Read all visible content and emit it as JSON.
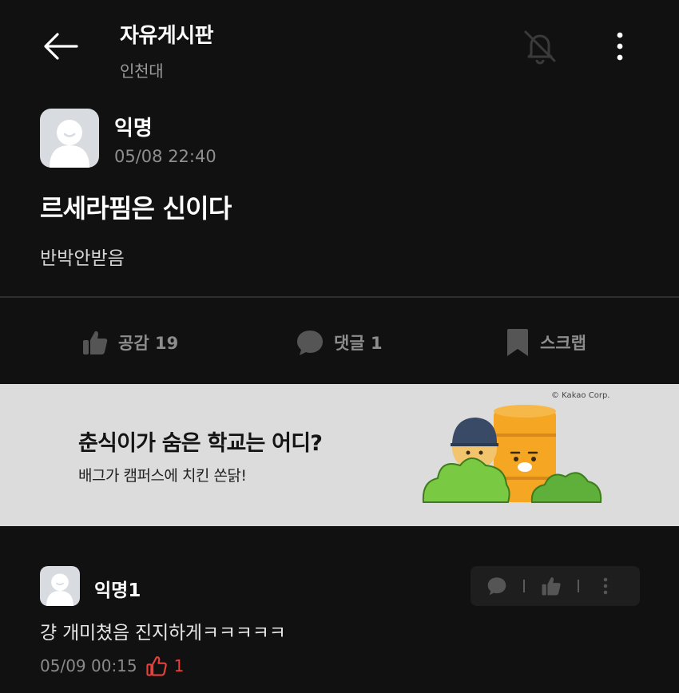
{
  "header": {
    "title": "자유게시판",
    "subtitle": "인천대"
  },
  "post": {
    "author": "익명",
    "date": "05/08 22:40",
    "title": "르세라핌은 신이다",
    "body": "반박안받음"
  },
  "actions": {
    "like_label": "공감 19",
    "comment_label": "댓글 1",
    "scrap_label": "스크랩"
  },
  "ad": {
    "heading": "춘식이가 숨은 학교는 어디?",
    "subheading": "배그가 캠퍼스에 치킨 쏜닭!",
    "copyright": "© Kakao Corp."
  },
  "comments": [
    {
      "author": "익명1",
      "text": "걍 개미쳤음 진지하게ㅋㅋㅋㅋㅋ",
      "date": "05/09 00:15",
      "likes": "1"
    }
  ],
  "colors": {
    "background": "#121112",
    "like_accent": "#e8403a",
    "muted_text": "#8d8d8d",
    "banner_bg": "#dcdcdc"
  },
  "icons": [
    "back-arrow-icon",
    "bell-off-icon",
    "more-vertical-icon",
    "thumbs-up-icon",
    "speech-bubble-icon",
    "bookmark-icon"
  ]
}
